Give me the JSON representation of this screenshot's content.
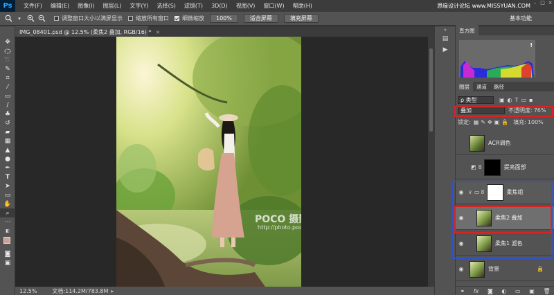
{
  "app": {
    "logo": "Ps"
  },
  "menu": [
    "文件(F)",
    "编辑(E)",
    "图像(I)",
    "图层(L)",
    "文字(Y)",
    "选择(S)",
    "滤镜(T)",
    "3D(D)",
    "视图(V)",
    "窗口(W)",
    "帮助(H)"
  ],
  "watermark": "思缘设计论坛 www.MISSYUAN.COM",
  "window_controls": [
    "–",
    "□",
    "×"
  ],
  "options": {
    "zoom_in_icon": "zoom-in-icon",
    "resize_windows_label": "调整窗口大小以满屏显示",
    "zoom_all_windows_label": "缩放所有窗口",
    "scrubby_zoom_label": "细微缩放",
    "zoom_value": "100%",
    "fit_screen_label": "适合屏幕",
    "fill_screen_label": "填充屏幕"
  },
  "workspace_label": "基本功能",
  "document": {
    "tab_title": "IMG_08401.psd @ 12.5% (柔焦2 叠加, RGB/16) *",
    "close": "×"
  },
  "status": {
    "zoom": "12.5%",
    "doc_size": "文档:114.2M/783.8M"
  },
  "photo_watermark": {
    "brand": "POCO 摄影专题",
    "url": "http://photo.poco.cn/"
  },
  "histogram_panel": {
    "tab": "直方图",
    "warning": "!"
  },
  "layers_panel": {
    "tabs": [
      "图层",
      "通道",
      "路径"
    ],
    "filter_kind": "ρ 类型",
    "blend_mode": "叠加",
    "opacity_label": "不透明度:",
    "opacity_value": "76%",
    "lock_label": "锁定:",
    "fill_label": "填充:",
    "fill_value": "100%",
    "layers": [
      {
        "name": "ACR调色",
        "visible": false
      },
      {
        "name": "提亮面部",
        "visible": false
      },
      {
        "name": "柔焦组",
        "visible": true
      },
      {
        "name": "柔焦2 叠加",
        "visible": true
      },
      {
        "name": "柔焦1 滤色",
        "visible": true
      },
      {
        "name": "背景",
        "visible": true
      }
    ],
    "bottom_icons": [
      "link-icon",
      "fx-icon",
      "mask-icon",
      "adjustment-icon",
      "folder-icon",
      "new-layer-icon",
      "trash-icon"
    ]
  },
  "colors": {
    "red_highlight": "#d22222",
    "blue_highlight": "#3352c8",
    "panel_bg": "#535353"
  }
}
